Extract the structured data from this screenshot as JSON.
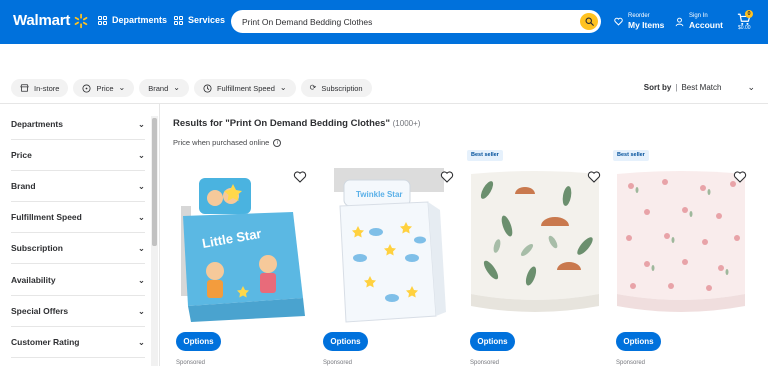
{
  "header": {
    "logo": "Walmart",
    "departments": "Departments",
    "services": "Services",
    "search_value": "Print On Demand Bedding Clothes",
    "reorder_small": "Reorder",
    "reorder_big": "My Items",
    "signin_small": "Sign In",
    "signin_big": "Account",
    "cart_count": "0",
    "cart_total": "$0.00",
    "brand_color": "#0071dc",
    "accent_color": "#ffc220"
  },
  "filters": {
    "chips": [
      "In-store",
      "Price",
      "Brand",
      "Fulfillment Speed",
      "Subscription"
    ],
    "sort_label": "Sort by",
    "sort_value": "Best Match"
  },
  "sidebar": {
    "items": [
      "Departments",
      "Price",
      "Brand",
      "Fulfillment Speed",
      "Subscription",
      "Availability",
      "Special Offers",
      "Customer Rating"
    ]
  },
  "results": {
    "title_prefix": "Results for \"Print On Demand Bedding Clothes\"",
    "count": "(1000+)",
    "price_note": "Price when purchased online"
  },
  "products": [
    {
      "badge": "",
      "image": "kids-bedding-set-little-star",
      "button": "Options",
      "sponsored": "Sponsored"
    },
    {
      "badge": "",
      "image": "twin-bedding-stars-clouds",
      "button": "Options",
      "sponsored": "Sponsored"
    },
    {
      "badge": "Best seller",
      "image": "crib-sheet-leaf-print",
      "button": "Options",
      "sponsored": "Sponsored"
    },
    {
      "badge": "Best seller",
      "image": "crib-sheet-pink-floral",
      "button": "Options",
      "sponsored": "Sponsored"
    }
  ]
}
